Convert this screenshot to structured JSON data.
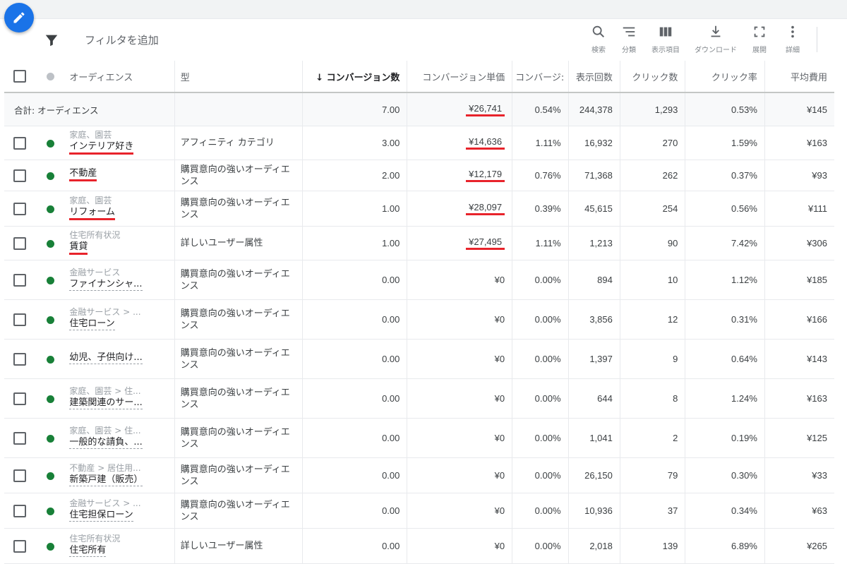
{
  "toolbar": {
    "filter_label": "フィルタを追加",
    "tools": [
      {
        "icon": "search-icon",
        "label": "検索"
      },
      {
        "icon": "segment-icon",
        "label": "分類"
      },
      {
        "icon": "columns-icon",
        "label": "表示項目"
      },
      {
        "icon": "download-icon",
        "label": "ダウンロード"
      },
      {
        "icon": "expand-icon",
        "label": "展開"
      },
      {
        "icon": "more-vert-icon",
        "label": "詳細"
      }
    ]
  },
  "table": {
    "headers": {
      "audience": "オーディエンス",
      "type": "型",
      "conversions": "↓ コンバージョン数",
      "cost_per_conv": "コンバージョン単価",
      "conv_rate": "コンバージ:",
      "impressions": "表示回数",
      "clicks": "クリック数",
      "ctr": "クリック率",
      "avg_cost": "平均費用"
    },
    "total": {
      "label": "合計: オーディエンス",
      "conversions": "7.00",
      "cost_per_conv": "¥26,741",
      "conv_rate": "0.54%",
      "impressions": "244,378",
      "clicks": "1,293",
      "ctr": "0.53%",
      "avg_cost": "¥145"
    },
    "rows": [
      {
        "category": "家庭、園芸",
        "name": "インテリア好き",
        "type": "アフィニティ カテゴリ",
        "conversions": "3.00",
        "cost_per_conv": "¥14,636",
        "conv_rate": "1.11%",
        "impressions": "16,932",
        "clicks": "270",
        "ctr": "1.59%",
        "avg_cost": "¥163",
        "name_highlight": true,
        "cost_highlight": true
      },
      {
        "category": "",
        "name": "不動産",
        "type": "購買意向の強いオーディエンス",
        "conversions": "2.00",
        "cost_per_conv": "¥12,179",
        "conv_rate": "0.76%",
        "impressions": "71,368",
        "clicks": "262",
        "ctr": "0.37%",
        "avg_cost": "¥93",
        "name_highlight": true,
        "cost_highlight": true
      },
      {
        "category": "家庭、園芸",
        "name": "リフォーム",
        "type": "購買意向の強いオーディエンス",
        "conversions": "1.00",
        "cost_per_conv": "¥28,097",
        "conv_rate": "0.39%",
        "impressions": "45,615",
        "clicks": "254",
        "ctr": "0.56%",
        "avg_cost": "¥111",
        "name_highlight": true,
        "cost_highlight": true
      },
      {
        "category": "住宅所有状況",
        "name": "賃貸",
        "type": "詳しいユーザー属性",
        "conversions": "1.00",
        "cost_per_conv": "¥27,495",
        "conv_rate": "1.11%",
        "impressions": "1,213",
        "clicks": "90",
        "ctr": "7.42%",
        "avg_cost": "¥306",
        "name_highlight": true,
        "cost_highlight": true
      },
      {
        "category": "金融サービス",
        "name": "ファイナンシャ...",
        "type": "購買意向の強いオーディエンス",
        "conversions": "0.00",
        "cost_per_conv": "¥0",
        "conv_rate": "0.00%",
        "impressions": "894",
        "clicks": "10",
        "ctr": "1.12%",
        "avg_cost": "¥185",
        "name_highlight": false,
        "cost_highlight": false
      },
      {
        "category": "金融サービス > ...",
        "name": "住宅ローン",
        "type": "購買意向の強いオーディエンス",
        "conversions": "0.00",
        "cost_per_conv": "¥0",
        "conv_rate": "0.00%",
        "impressions": "3,856",
        "clicks": "12",
        "ctr": "0.31%",
        "avg_cost": "¥166",
        "name_highlight": false,
        "cost_highlight": false
      },
      {
        "category": "",
        "name": "幼児、子供向け...",
        "type": "購買意向の強いオーディエンス",
        "conversions": "0.00",
        "cost_per_conv": "¥0",
        "conv_rate": "0.00%",
        "impressions": "1,397",
        "clicks": "9",
        "ctr": "0.64%",
        "avg_cost": "¥143",
        "name_highlight": false,
        "cost_highlight": false
      },
      {
        "category": "家庭、園芸 > 住...",
        "name": "建築関連のサー...",
        "type": "購買意向の強いオーディエンス",
        "conversions": "0.00",
        "cost_per_conv": "¥0",
        "conv_rate": "0.00%",
        "impressions": "644",
        "clicks": "8",
        "ctr": "1.24%",
        "avg_cost": "¥163",
        "name_highlight": false,
        "cost_highlight": false
      },
      {
        "category": "家庭、園芸 > 住...",
        "name": "一般的な請負、...",
        "type": "購買意向の強いオーディエンス",
        "conversions": "0.00",
        "cost_per_conv": "¥0",
        "conv_rate": "0.00%",
        "impressions": "1,041",
        "clicks": "2",
        "ctr": "0.19%",
        "avg_cost": "¥125",
        "name_highlight": false,
        "cost_highlight": false
      },
      {
        "category": "不動産 > 居住用...",
        "name": "新築戸建（販売）",
        "type": "購買意向の強いオーディエンス",
        "conversions": "0.00",
        "cost_per_conv": "¥0",
        "conv_rate": "0.00%",
        "impressions": "26,150",
        "clicks": "79",
        "ctr": "0.30%",
        "avg_cost": "¥33",
        "name_highlight": false,
        "cost_highlight": false
      },
      {
        "category": "金融サービス > ...",
        "name": "住宅担保ローン",
        "type": "購買意向の強いオーディエンス",
        "conversions": "0.00",
        "cost_per_conv": "¥0",
        "conv_rate": "0.00%",
        "impressions": "10,936",
        "clicks": "37",
        "ctr": "0.34%",
        "avg_cost": "¥63",
        "name_highlight": false,
        "cost_highlight": false
      },
      {
        "category": "住宅所有状況",
        "name": "住宅所有",
        "type": "詳しいユーザー属性",
        "conversions": "0.00",
        "cost_per_conv": "¥0",
        "conv_rate": "0.00%",
        "impressions": "2,018",
        "clicks": "139",
        "ctr": "6.89%",
        "avg_cost": "¥265",
        "name_highlight": false,
        "cost_highlight": false
      }
    ]
  },
  "colors": {
    "accent": "#1a73e8",
    "enabled_dot": "#188038",
    "highlight": "#e8232b"
  }
}
